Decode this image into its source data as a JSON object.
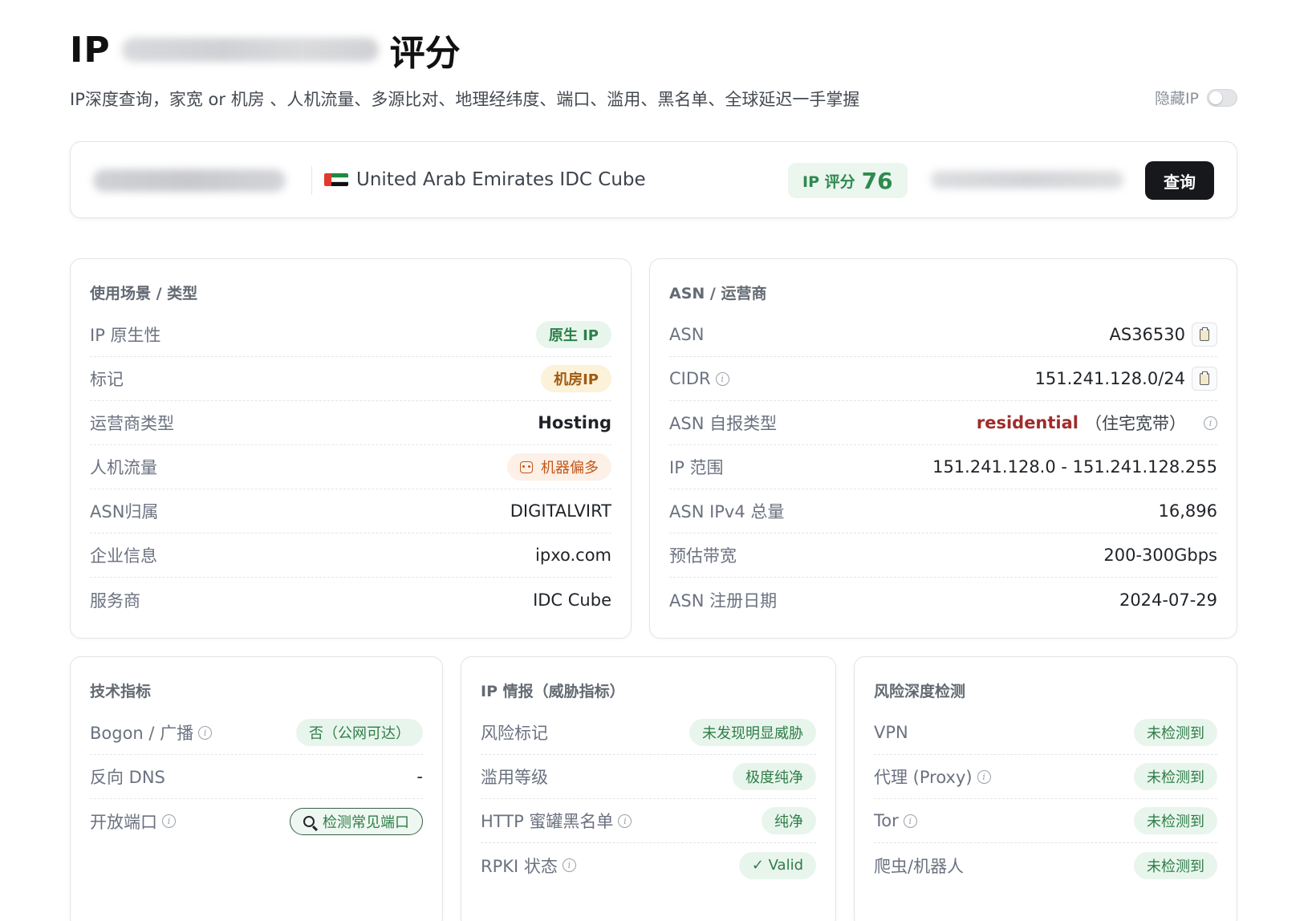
{
  "header": {
    "title_prefix": "IP",
    "title_suffix": "评分",
    "subtitle": "IP深度查询，家宽 or 机房 、人机流量、多源比对、地理经纬度、端口、滥用、黑名单、全球延迟一手掌握",
    "hide_ip_label": "隐藏IP"
  },
  "search": {
    "location": "United Arab Emirates IDC Cube",
    "flag": "uae-flag-icon",
    "score_label": "IP 评分",
    "score_value": "76",
    "query_label": "查询"
  },
  "usage": {
    "title": "使用场景 / 类型",
    "rows": [
      {
        "label": "IP 原生性",
        "value": "原生 IP"
      },
      {
        "label": "标记",
        "value": "机房IP"
      },
      {
        "label": "运营商类型",
        "value": "Hosting"
      },
      {
        "label": "人机流量",
        "value": "机器偏多"
      },
      {
        "label": "ASN归属",
        "value": "DIGITALVIRT"
      },
      {
        "label": "企业信息",
        "value": "ipxo.com"
      },
      {
        "label": "服务商",
        "value": "IDC Cube"
      }
    ]
  },
  "asn": {
    "title": "ASN / 运营商",
    "rows": [
      {
        "label": "ASN",
        "value": "AS36530"
      },
      {
        "label": "CIDR",
        "value": "151.241.128.0/24"
      },
      {
        "label": "ASN 自报类型",
        "value": "residential",
        "value_zh": "（住宅宽带）"
      },
      {
        "label": "IP 范围",
        "value": "151.241.128.0 - 151.241.128.255"
      },
      {
        "label": "ASN IPv4 总量",
        "value": "16,896"
      },
      {
        "label": "预估带宽",
        "value": "200-300Gbps"
      },
      {
        "label": "ASN 注册日期",
        "value": "2024-07-29"
      }
    ]
  },
  "tech": {
    "title": "技术指标",
    "rows": [
      {
        "label": "Bogon / 广播",
        "value": "否（公网可达）"
      },
      {
        "label": "反向 DNS",
        "value": "-"
      },
      {
        "label": "开放端口",
        "value": "检测常见端口"
      }
    ]
  },
  "intel": {
    "title": "IP 情报（威胁指标）",
    "rows": [
      {
        "label": "风险标记",
        "value": "未发现明显威胁"
      },
      {
        "label": "滥用等级",
        "value": "极度纯净"
      },
      {
        "label": "HTTP 蜜罐黑名单",
        "value": "纯净"
      },
      {
        "label": "RPKI 状态",
        "value": "✓ Valid"
      }
    ]
  },
  "risk": {
    "title": "风险深度检测",
    "rows": [
      {
        "label": "VPN",
        "value": "未检测到"
      },
      {
        "label": "代理 (Proxy)",
        "value": "未检测到"
      },
      {
        "label": "Tor",
        "value": "未检测到"
      },
      {
        "label": "爬虫/机器人",
        "value": "未检测到"
      }
    ]
  },
  "colors": {
    "accent_green": "#2e8a4f",
    "amber": "#a15a10",
    "residential_red": "#9f2c2c",
    "button_dark": "#16181b"
  }
}
